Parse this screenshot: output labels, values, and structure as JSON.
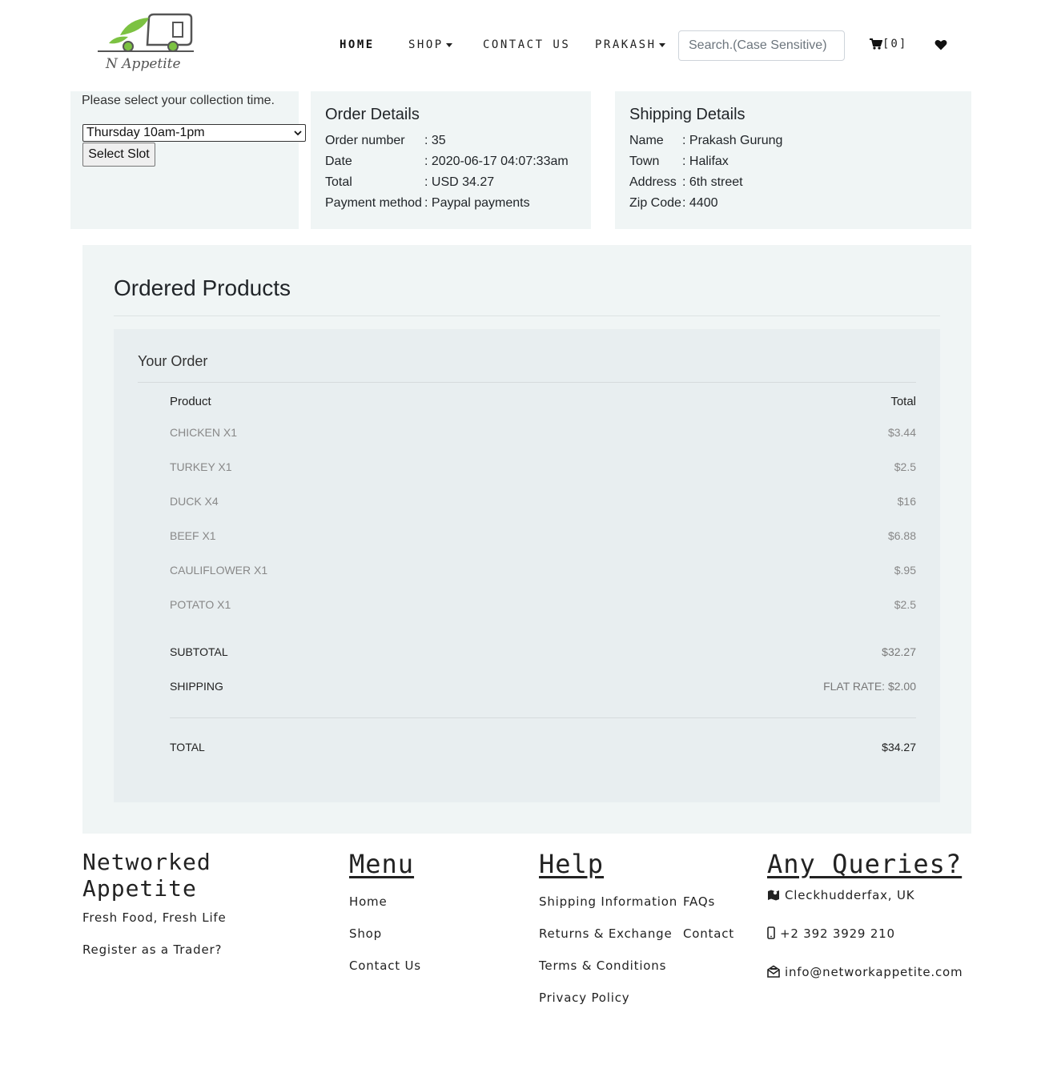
{
  "brand": {
    "logo_text": "N Appetite"
  },
  "nav": {
    "home": "HOME",
    "shop": "SHOP",
    "contact": "CONTACT US",
    "user": "PRAKASH",
    "search_placeholder": "Search.(Case Sensitive)",
    "cart": "[0]"
  },
  "slot": {
    "label": "Please select your collection time.",
    "selected": "Thursday 10am-1pm",
    "button": "Select Slot"
  },
  "order_details": {
    "title": "Order Details",
    "rows": [
      {
        "k": "Order number",
        "v": ": 35"
      },
      {
        "k": "Date",
        "v": ": 2020-06-17 04:07:33am"
      },
      {
        "k": "Total",
        "v": ": USD 34.27"
      },
      {
        "k": "Payment method",
        "v": ": Paypal payments"
      }
    ]
  },
  "shipping_details": {
    "title": "Shipping Details",
    "rows": [
      {
        "k": "Name",
        "v": ": Prakash Gurung"
      },
      {
        "k": "Town",
        "v": ": Halifax"
      },
      {
        "k": "Address",
        "v": ": 6th street"
      },
      {
        "k": "Zip Code",
        "v": ": 4400"
      }
    ]
  },
  "ordered": {
    "title": "Ordered Products",
    "your_order": "Your Order",
    "head_product": "Product",
    "head_total": "Total",
    "items": [
      {
        "name": "CHICKEN X1",
        "total": "$3.44"
      },
      {
        "name": "TURKEY X1",
        "total": "$2.5"
      },
      {
        "name": "DUCK X4",
        "total": "$16"
      },
      {
        "name": "BEEF X1",
        "total": "$6.88"
      },
      {
        "name": "CAULIFLOWER X1",
        "total": "$.95"
      },
      {
        "name": "POTATO X1",
        "total": "$2.5"
      }
    ],
    "subtotal_label": "SUBTOTAL",
    "subtotal": "$32.27",
    "shipping_label": "SHIPPING",
    "shipping": "FLAT RATE: $2.00",
    "total_label": "TOTAL",
    "total": "$34.27"
  },
  "footer": {
    "brand": "Networked Appetite",
    "tagline": "Fresh Food, Fresh Life",
    "register": "Register as a Trader?",
    "menu_title": "Menu",
    "menu": [
      "Home",
      "Shop",
      "Contact Us"
    ],
    "help_title": "Help",
    "help_col1": [
      "Shipping Information",
      "Returns & Exchange",
      "Terms & Conditions",
      "Privacy Policy"
    ],
    "help_col2": [
      "FAQs",
      "Contact"
    ],
    "queries_title": "Any Queries?",
    "location": "Cleckhudderfax, UK",
    "phone": "+2 392 3929 210",
    "email": "info@networkappetite.com"
  },
  "colors": {
    "panel_bg": "#f0f5f5",
    "order_box_bg": "#e8eef0",
    "logo_green": "#7cc242"
  }
}
